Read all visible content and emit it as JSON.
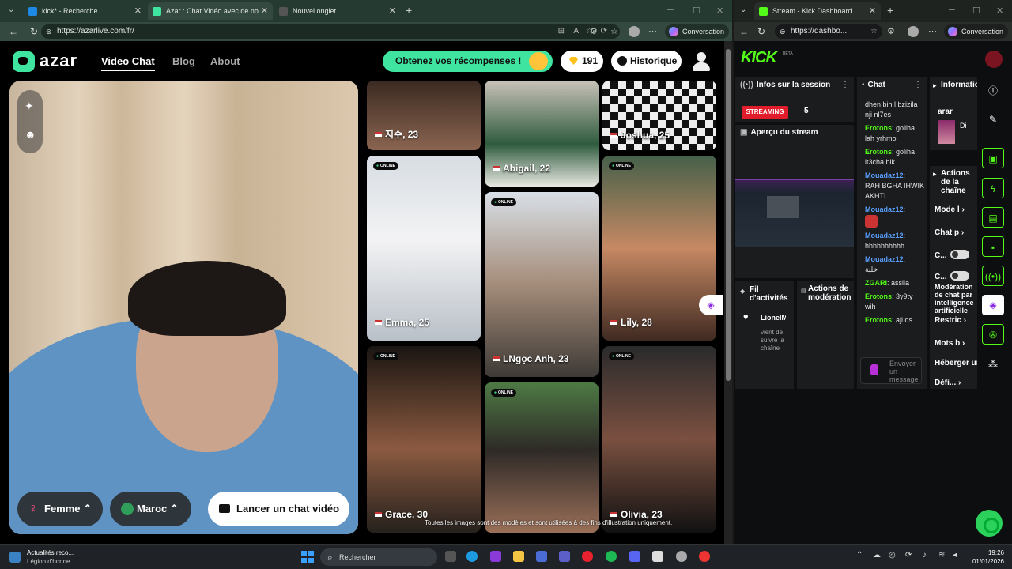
{
  "left_browser": {
    "tabs": [
      {
        "title": "kick* - Recherche"
      },
      {
        "title": "Azar : Chat Vidéo avec de no"
      },
      {
        "title": "Nouvel onglet"
      }
    ],
    "url": "https://azarlive.com/fr/",
    "conversation_label": "Conversation"
  },
  "azar": {
    "brand": "azar",
    "nav": [
      "Video Chat",
      "Blog",
      "About"
    ],
    "rewards_label": "Obtenez vos récompenses !",
    "gems_count": "191",
    "history_label": "Historique",
    "gender_filter": "Femme",
    "country_filter": "Maroc",
    "launch_label": "Lancer un chat vidéo",
    "online_badge": "ONLINE",
    "disclaimer": "Toutes les images sont des modèles et sont utilisées à des fins d'illustration uniquement.",
    "cards": [
      {
        "name": "지수, 23",
        "online": false
      },
      {
        "name": "Abigail, 22",
        "online": false
      },
      {
        "name": "Joshua, 25",
        "online": false
      },
      {
        "name": "Emma, 25",
        "online": true
      },
      {
        "name": "LNgọc Anh, 23",
        "online": true
      },
      {
        "name": "Lily, 28",
        "online": true
      },
      {
        "name": "Grace, 30",
        "online": true
      },
      {
        "name": "",
        "online": true
      },
      {
        "name": "Olivia, 23",
        "online": true
      }
    ]
  },
  "right_browser": {
    "tab_title": "Stream - Kick Dashboard",
    "url": "https://dashbo...",
    "conversation_label": "Conversation"
  },
  "kick": {
    "logo": "KICK",
    "beta": "BETA",
    "session_title": "Infos sur la session",
    "streaming_badge": "STREAMING",
    "viewer_count": "5",
    "preview_title": "Aperçu du stream",
    "activity_title": "Fil d'activités",
    "activity_user": "LionelM",
    "activity_text": "vient de suivre la chaîne",
    "moderation_title": "Actions de modération",
    "chat_title": "Chat",
    "chat_messages": [
      {
        "user": "",
        "text": "dhen bih l bzizila nji nl7es",
        "color": "green"
      },
      {
        "user": "Erotons",
        "text": "goliha lah yrhmo",
        "color": "green"
      },
      {
        "user": "Erotons",
        "text": "goliha it3cha bik",
        "color": "green"
      },
      {
        "user": "Mouadaz12",
        "text": "RAH BGHA IHWIK AKHTI",
        "color": "blue"
      },
      {
        "user": "Mouadaz12",
        "text": "",
        "color": "blue"
      },
      {
        "user": "Mouadaz12",
        "text": "hhhhhhhhhh",
        "color": "blue"
      },
      {
        "user": "Mouadaz12",
        "text": "خلية",
        "color": "blue"
      },
      {
        "user": "ZGARI",
        "text": "assila",
        "color": "green"
      },
      {
        "user": "Erotons",
        "text": "3y9ty wih",
        "color": "green"
      },
      {
        "user": "Erotons",
        "text": "aji ds",
        "color": "green"
      }
    ],
    "chat_placeholder": "Envoyer un message",
    "info_title": "Informations sur le stream",
    "info_name": "arar",
    "info_sub": "Di",
    "actions_title": "Actions de la chaîne",
    "actions": [
      "Mode l",
      "Chat p",
      "C...",
      "C...",
      "Modération de chat par intelligence artificielle",
      "Restric",
      "Mots b",
      "Héberger ur",
      "Défi..."
    ]
  },
  "taskbar": {
    "news_title": "Actualités reco...",
    "news_sub": "Légion d'honne...",
    "search_label": "Rechercher",
    "time": "19:26",
    "date": "01/01/2026"
  }
}
